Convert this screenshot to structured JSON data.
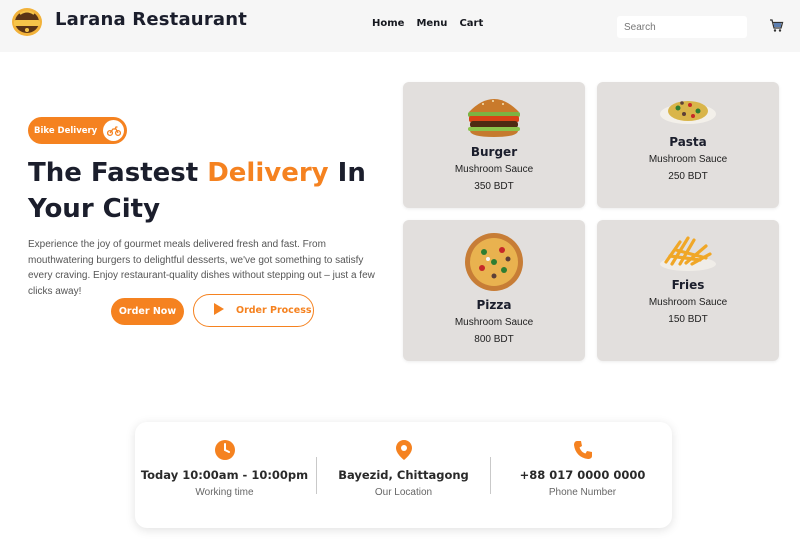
{
  "header": {
    "brand": "Larana Restaurant",
    "nav": [
      "Home",
      "Menu",
      "Cart"
    ],
    "search_placeholder": "Search"
  },
  "hero": {
    "badge": "Bike Delivery",
    "headline_part1": "The Fastest ",
    "headline_accent": "Delivery",
    "headline_part2": " In Your City",
    "description": "Experience the joy of gourmet meals delivered fresh and fast. From mouthwatering burgers to delightful desserts, we've got something to satisfy every craving. Enjoy restaurant-quality dishes without stepping out – just a few clicks away!",
    "order_now": "Order Now",
    "order_process": "Order Process"
  },
  "foods": [
    {
      "name": "Burger",
      "sauce": "Mushroom Sauce",
      "price": "350 BDT"
    },
    {
      "name": "Pasta",
      "sauce": "Mushroom Sauce",
      "price": "250 BDT"
    },
    {
      "name": "Pizza",
      "sauce": "Mushroom Sauce",
      "price": "800 BDT"
    },
    {
      "name": "Fries",
      "sauce": "Mushroom Sauce",
      "price": "150 BDT"
    }
  ],
  "info": [
    {
      "icon": "clock-icon",
      "value": "Today 10:00am - 10:00pm",
      "label": "Working time"
    },
    {
      "icon": "location-pin-icon",
      "value": "Bayezid, Chittagong",
      "label": "Our Location"
    },
    {
      "icon": "phone-icon",
      "value": "+88 017 0000 0000",
      "label": "Phone Number"
    }
  ],
  "colors": {
    "accent": "#f58220",
    "card_bg": "#e2dfdd",
    "header_bg": "#f6f6f6",
    "text_dark": "#1b1e2c"
  }
}
